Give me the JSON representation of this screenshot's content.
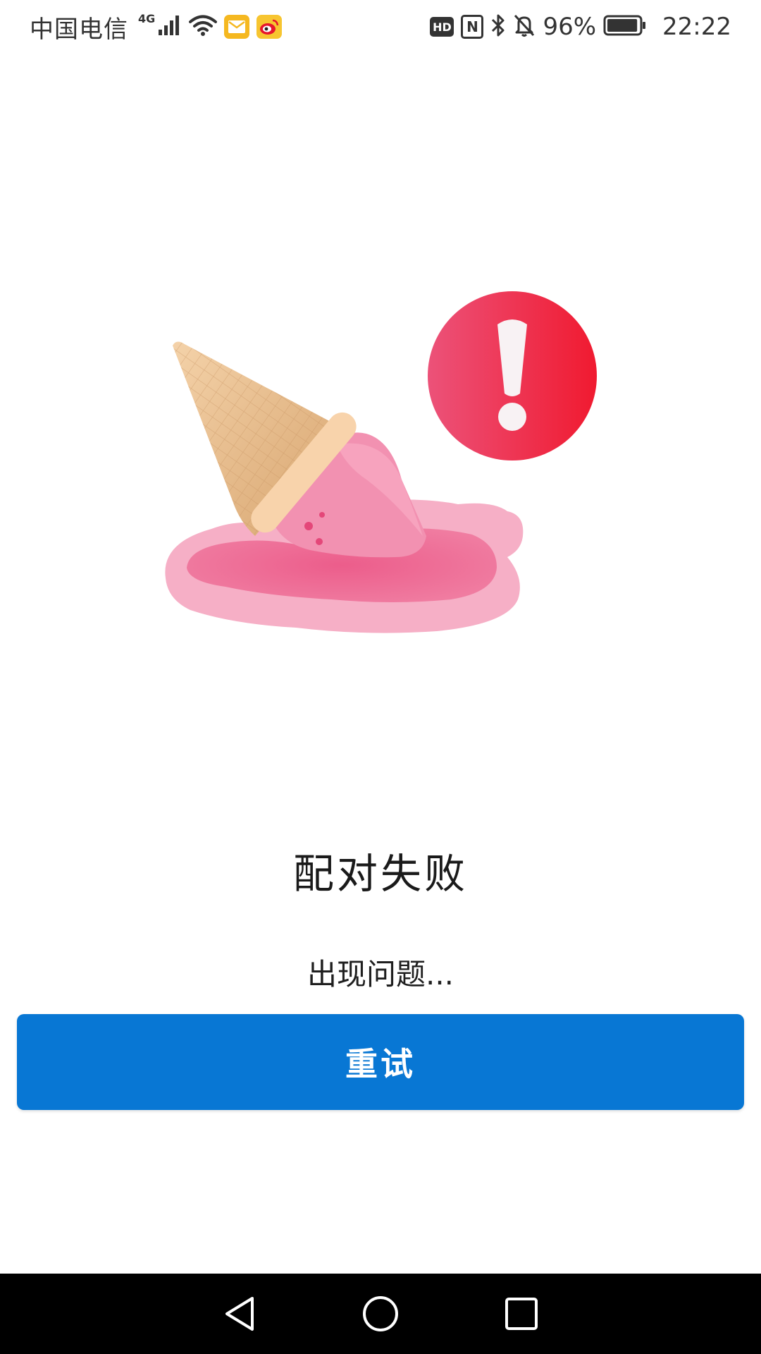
{
  "status_bar": {
    "carrier": "中国电信",
    "network_type": "4G",
    "hd_label": "HD",
    "nfc_label": "N",
    "battery_percent": "96%",
    "time": "22:22",
    "icons": [
      "signal-icon",
      "wifi-icon",
      "mail-app-icon",
      "weibo-app-icon",
      "hd-icon",
      "nfc-icon",
      "bluetooth-icon",
      "mute-bell-icon",
      "battery-icon"
    ],
    "battery_level": 0.96
  },
  "main": {
    "illustration": "melted-ice-cream-error",
    "title": "配对失败",
    "message": "出现问题...",
    "retry_label": "重试"
  },
  "nav_bar": {
    "buttons": [
      "back-icon",
      "home-icon",
      "recents-icon"
    ]
  },
  "colors": {
    "accent": "#0877d4",
    "error_red": "#ee1c3a",
    "pink": "#f07ea2",
    "cone": "#e3b889"
  }
}
